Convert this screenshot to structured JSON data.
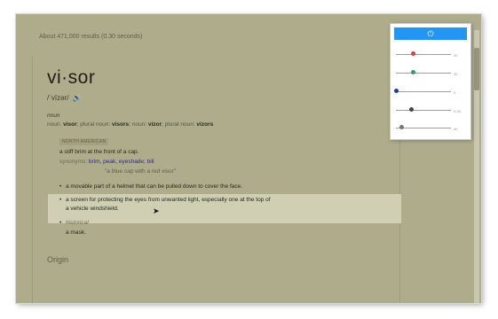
{
  "results": {
    "stats": "About 471,000 results (0.30 seconds)"
  },
  "entry": {
    "word": "vi·sor",
    "phonetic": "/ˈvīzər/",
    "speaker_icon": "speaker-icon",
    "part_of_speech": "noun",
    "forms_prefix": "noun: ",
    "form1": "visor",
    "forms_sep1": "; plural noun: ",
    "form2": "visors",
    "forms_sep2": "; noun: ",
    "form3": "vizor",
    "forms_sep3": "; plural noun: ",
    "form4": "vizors",
    "region_label": "NORTH AMERICAN",
    "definition1": "a stiff brim at the front of a cap.",
    "synonyms_label": "synonyms:",
    "synonyms": "brim, peak, eyeshade; bill",
    "example1": "\"a blue cap with a red visor\"",
    "definition2": "a movable part of a helmet that can be pulled down to cover the face.",
    "definition3_line1": "a screen for protecting the eyes from unwanted light, especially one at the top of",
    "definition3_line2": "a vehicle windshield.",
    "historical_label": "historical",
    "definition4": "a mask.",
    "origin_label": "Origin"
  },
  "panel": {
    "power_icon": "power-icon",
    "power_glyph": "⏻",
    "sliders": [
      {
        "color": "#e53935",
        "level": 0.3,
        "value": "30"
      },
      {
        "color": "#2e9d6a",
        "level": 0.3,
        "value": "30"
      },
      {
        "color": "#1e3fa8",
        "level": 0.0,
        "value": "0"
      },
      {
        "color": "#444444",
        "level": 0.28,
        "value": "0.28"
      },
      {
        "color": "#777777",
        "level": 0.1,
        "value": "40"
      }
    ]
  }
}
